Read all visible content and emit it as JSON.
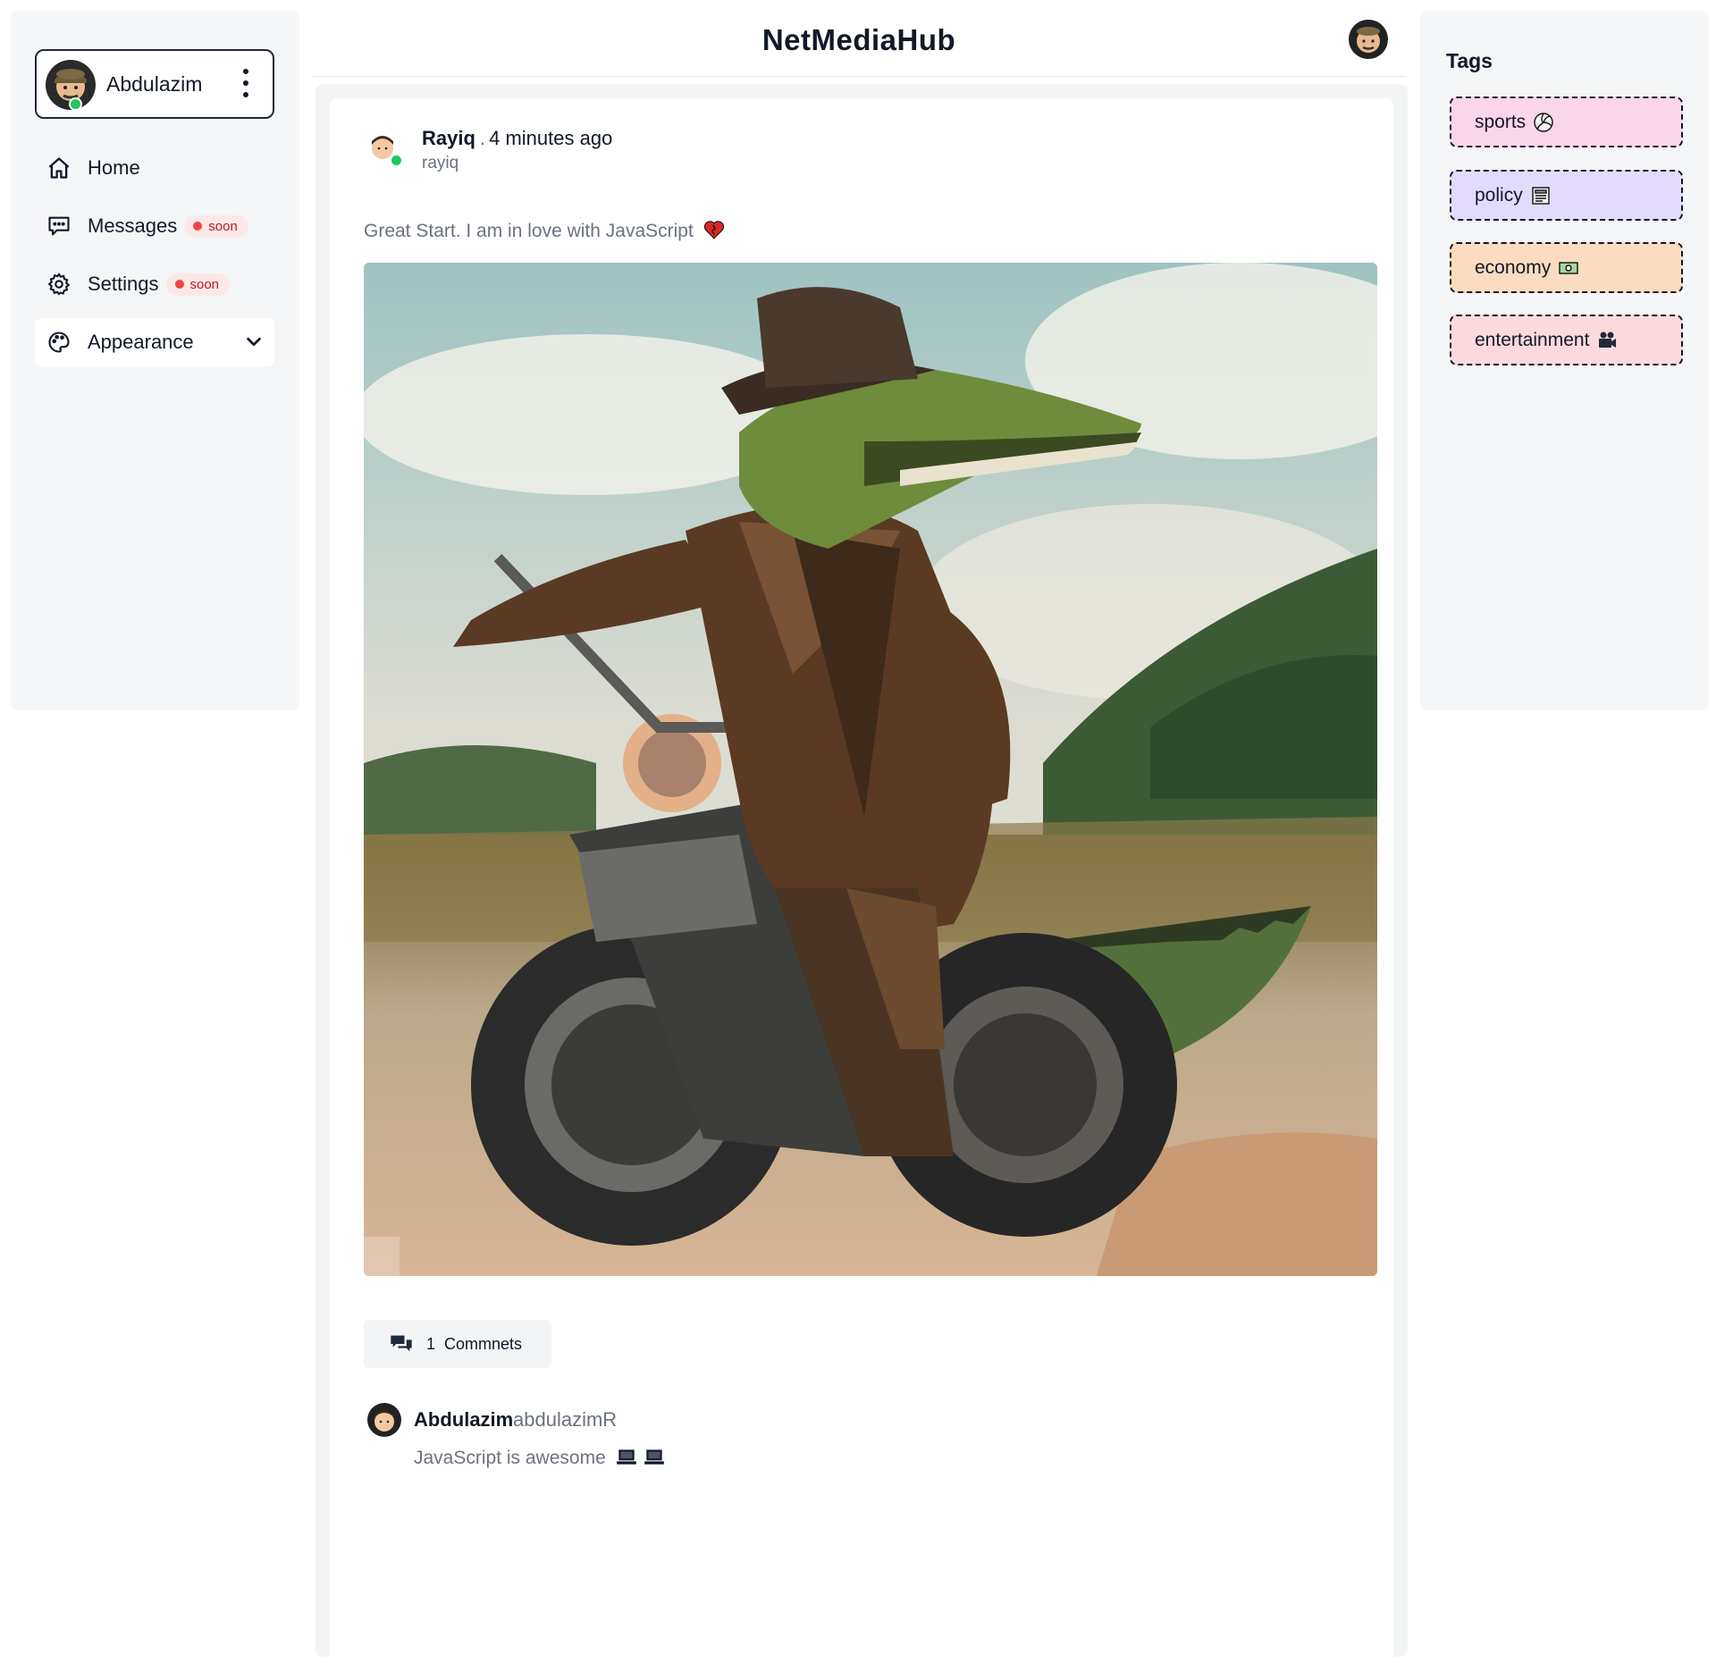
{
  "header": {
    "brand": "NetMediaHub"
  },
  "user": {
    "name": "Abdulazim"
  },
  "nav": {
    "items": [
      {
        "label": "Home",
        "icon": "home-icon"
      },
      {
        "label": "Messages",
        "icon": "message-icon",
        "badge": "soon"
      },
      {
        "label": "Settings",
        "icon": "gear-icon",
        "badge": "soon"
      },
      {
        "label": "Appearance",
        "icon": "palette-icon"
      }
    ]
  },
  "post": {
    "author": "Rayiq",
    "time": "4 minutes ago",
    "handle": "rayiq",
    "text": "Great Start. I am in love with JavaScript",
    "comments_count": "1",
    "comments_label": "Commnets"
  },
  "comment": {
    "author": "Abdulazim",
    "handle": "abdulazimR",
    "text": "JavaScript is awesome"
  },
  "tags": {
    "title": "Tags",
    "items": [
      {
        "label": "sports",
        "color": "#fbd5ea",
        "icon": "volleyball-icon"
      },
      {
        "label": "policy",
        "color": "#e2dbfd",
        "icon": "newspaper-icon"
      },
      {
        "label": "economy",
        "color": "#fbdcc0",
        "icon": "money-icon"
      },
      {
        "label": "entertainment",
        "color": "#fbd9dd",
        "icon": "camera-icon"
      }
    ]
  },
  "colors": {
    "online": "#22c55e",
    "soon_dot": "#ef4444"
  }
}
